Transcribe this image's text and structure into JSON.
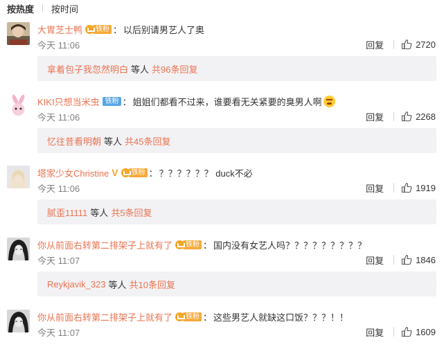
{
  "sort": {
    "hot": "按热度",
    "time": "按时间"
  },
  "colors": {
    "accent": "#eb7350",
    "fan_badge": "#f6a93a",
    "fan_badge_blue": "#5aa5e6"
  },
  "comments": [
    {
      "user": "大胃芝士鸭",
      "badge": "铁粉",
      "badge_style": "orange",
      "colon": "：",
      "text": "以后别请男艺人了奥",
      "time": "今天 11:06",
      "reply_label": "回复",
      "likes": "2720",
      "reply_user": "拿着包子我忽然明白",
      "reply_mid": "等人",
      "reply_count": "共96条回复"
    },
    {
      "user": "KIKI只想当米虫",
      "badge": "铁粉",
      "badge_style": "blue",
      "colon": "：",
      "text": "姐姐们都看不过来，谁要看无关紧要的臭男人啊",
      "emoji": "angry-emoji",
      "time": "今天 11:06",
      "reply_label": "回复",
      "likes": "2268",
      "reply_user": "忆往昔看明朝",
      "reply_mid": "等人",
      "reply_count": "共45条回复"
    },
    {
      "user": "塔家少女Christine",
      "badge": "铁粉",
      "badge_style": "orange",
      "vmark": "V",
      "colon": "：",
      "text": "？？？？？？ duck不必",
      "time": "今天 11:06",
      "reply_label": "回复",
      "likes": "1919",
      "reply_user": "腻歪11111",
      "reply_mid": "等人",
      "reply_count": "共5条回复"
    },
    {
      "user": "你从前面右转第二排架子上就有了",
      "badge": "铁粉",
      "badge_style": "orange",
      "colon": "：",
      "text": "国内没有女艺人吗？？？？？？？？？",
      "time": "今天 11:07",
      "reply_label": "回复",
      "likes": "1846",
      "reply_user": "Reykjavik_323",
      "reply_mid": "等人",
      "reply_count": "共10条回复"
    },
    {
      "user": "你从前面右转第二排架子上就有了",
      "badge": "铁粉",
      "badge_style": "orange",
      "colon": "：",
      "text": "这些男艺人就缺这口饭？？？！！",
      "time": "今天 11:07",
      "reply_label": "回复",
      "likes": "1609"
    }
  ]
}
